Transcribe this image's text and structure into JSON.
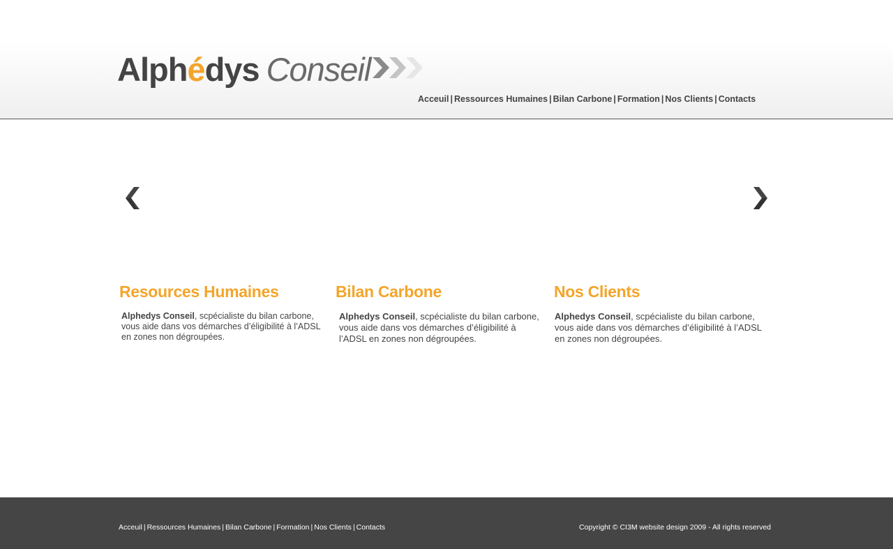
{
  "header": {
    "logo": {
      "brand_part1": "Alph",
      "brand_accent": "é",
      "brand_part2": "dys",
      "brand_suffix": "Conseil",
      "arrows_icon": "triple-chevron-right-icon"
    },
    "nav": {
      "items": [
        "Acceuil",
        "Ressources Humaines",
        "Bilan Carbone",
        "Formation",
        "Nos Clients",
        "Contacts"
      ],
      "separator": "|"
    }
  },
  "slider": {
    "prev_icon": "chevron-left-icon",
    "next_icon": "chevron-right-icon"
  },
  "columns": [
    {
      "title": "Resources Humaines",
      "bold": "Alphedys Conseil",
      "text": ", scpécialiste du bilan carbone, vous aide dans vos démarches d’éligibilité à l’ADSL en zones non dégroupées."
    },
    {
      "title": "Bilan Carbone",
      "bold": "Alphedys Conseil",
      "text": ", scpécialiste du bilan carbone, vous aide dans vos démarches d’éligibilité à l’ADSL en zones non dégroupées."
    },
    {
      "title": "Nos Clients",
      "bold": "Alphedys Conseil",
      "text": ", scpécialiste du bilan carbone, vous aide dans vos démarches d’éligibilité à l’ADSL en zones non dégroupées."
    }
  ],
  "footer": {
    "nav": {
      "items": [
        "Acceuil",
        "Ressources Humaines",
        "Bilan Carbone",
        "Formation",
        "Nos Clients",
        "Contacts"
      ],
      "separator": "|"
    },
    "copyright": "Copyright © CI3M website design 2009 - All rights reserved"
  },
  "colors": {
    "accent": "#f3a52a",
    "text": "#444444",
    "footer_bg": "#454545"
  }
}
